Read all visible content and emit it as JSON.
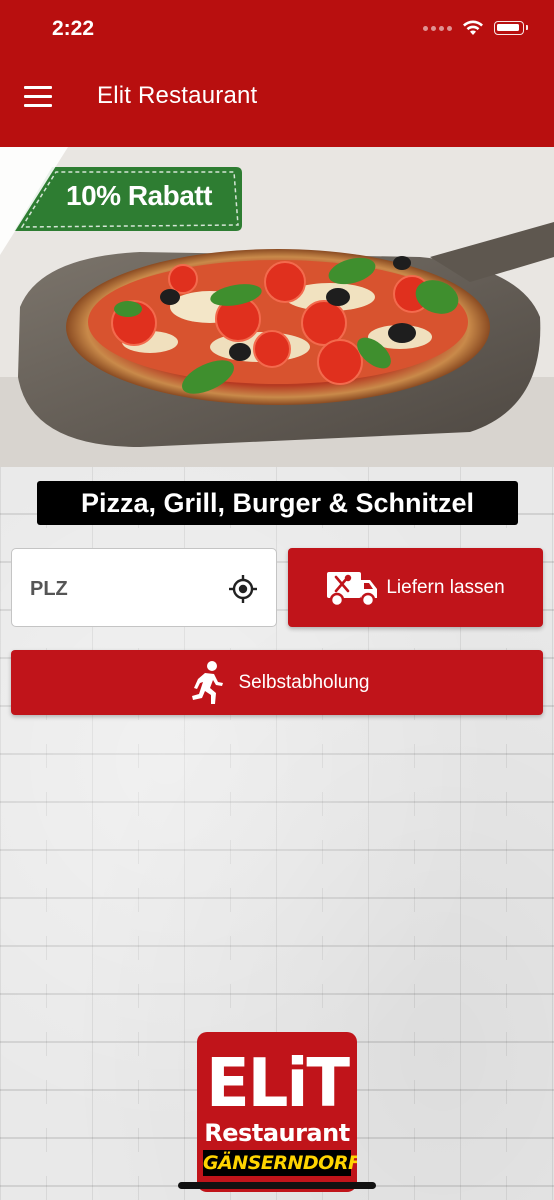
{
  "status_bar": {
    "time": "2:22"
  },
  "app_bar": {
    "title": "Elit Restaurant",
    "menu_icon": "hamburger-menu-icon"
  },
  "hero": {
    "badge_text": "10% Rabatt",
    "badge_color": "#2e7d32",
    "image": "pizza-on-wooden-peel"
  },
  "tagline": "Pizza, Grill, Burger & Schnitzel",
  "plz_field": {
    "placeholder": "PLZ",
    "value": "",
    "icon": "my-location-icon"
  },
  "deliver_button": {
    "label": "Liefern lassen",
    "icon": "delivery-truck-icon"
  },
  "pickup_button": {
    "label": "Selbstabholung",
    "icon": "running-person-icon"
  },
  "logo": {
    "line1": "ELiT",
    "line2": "Restaurant",
    "line3": "GÄNSERNDORF"
  },
  "colors": {
    "primary": "#b80f0f",
    "button": "#c0141a",
    "tagline_bg": "#000000",
    "city_text": "#ffd400"
  }
}
